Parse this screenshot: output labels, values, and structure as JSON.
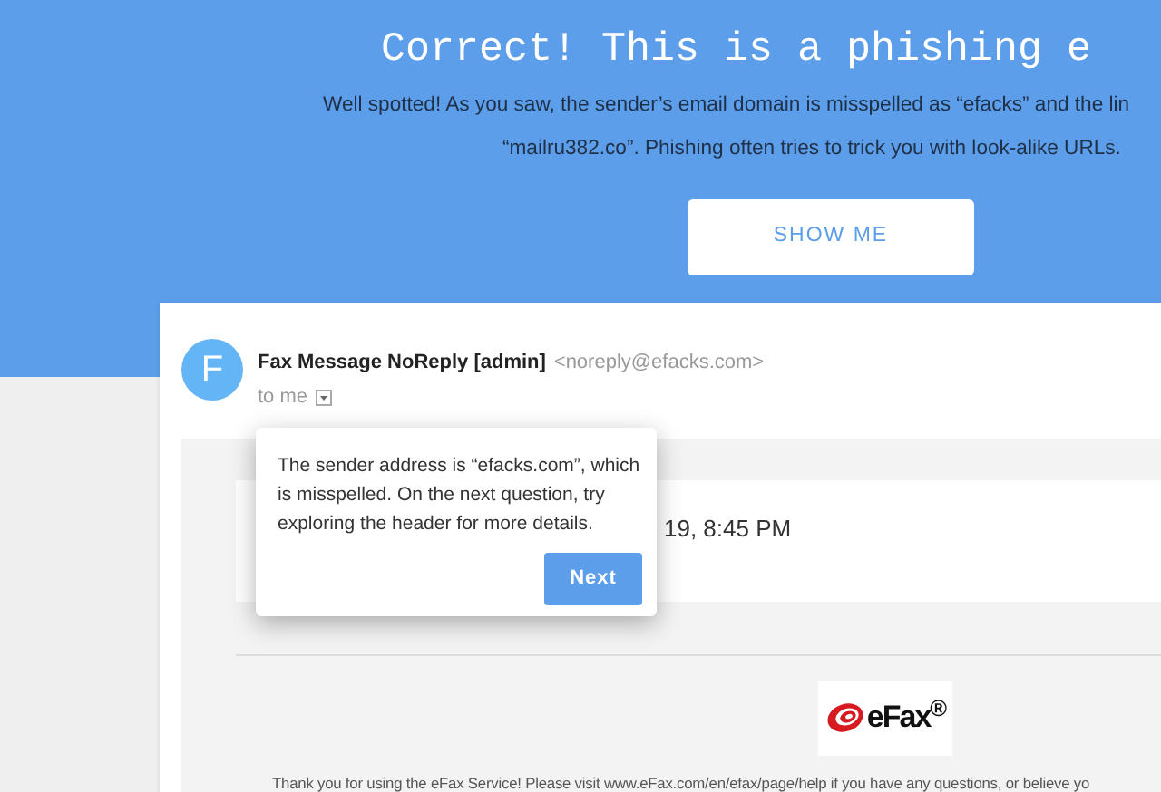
{
  "banner": {
    "title": "Correct! This is a phishing e",
    "lines": [
      "Well spotted! As you saw, the sender’s email domain is misspelled as “efacks” and the lin",
      "“mailru382.co”. Phishing often tries to trick you with look-alike URLs."
    ],
    "button": "SHOW ME"
  },
  "email": {
    "avatar": "F",
    "sender": "Fax Message NoReply [admin]",
    "address": "<noreply@efacks.com>",
    "recipient": "to me",
    "date": "19, 8:45 PM",
    "logo": "eFax$^{®}$",
    "footer": "Thank you for using the eFax Service! Please visit www.eFax.com/en/efax/page/help if you have any questions, or believe yo"
  },
  "popover": {
    "text": "The sender address is “efacks.com”, which is misspelled. On the next question, try exploring the header for more details.",
    "button": "Next"
  }
}
